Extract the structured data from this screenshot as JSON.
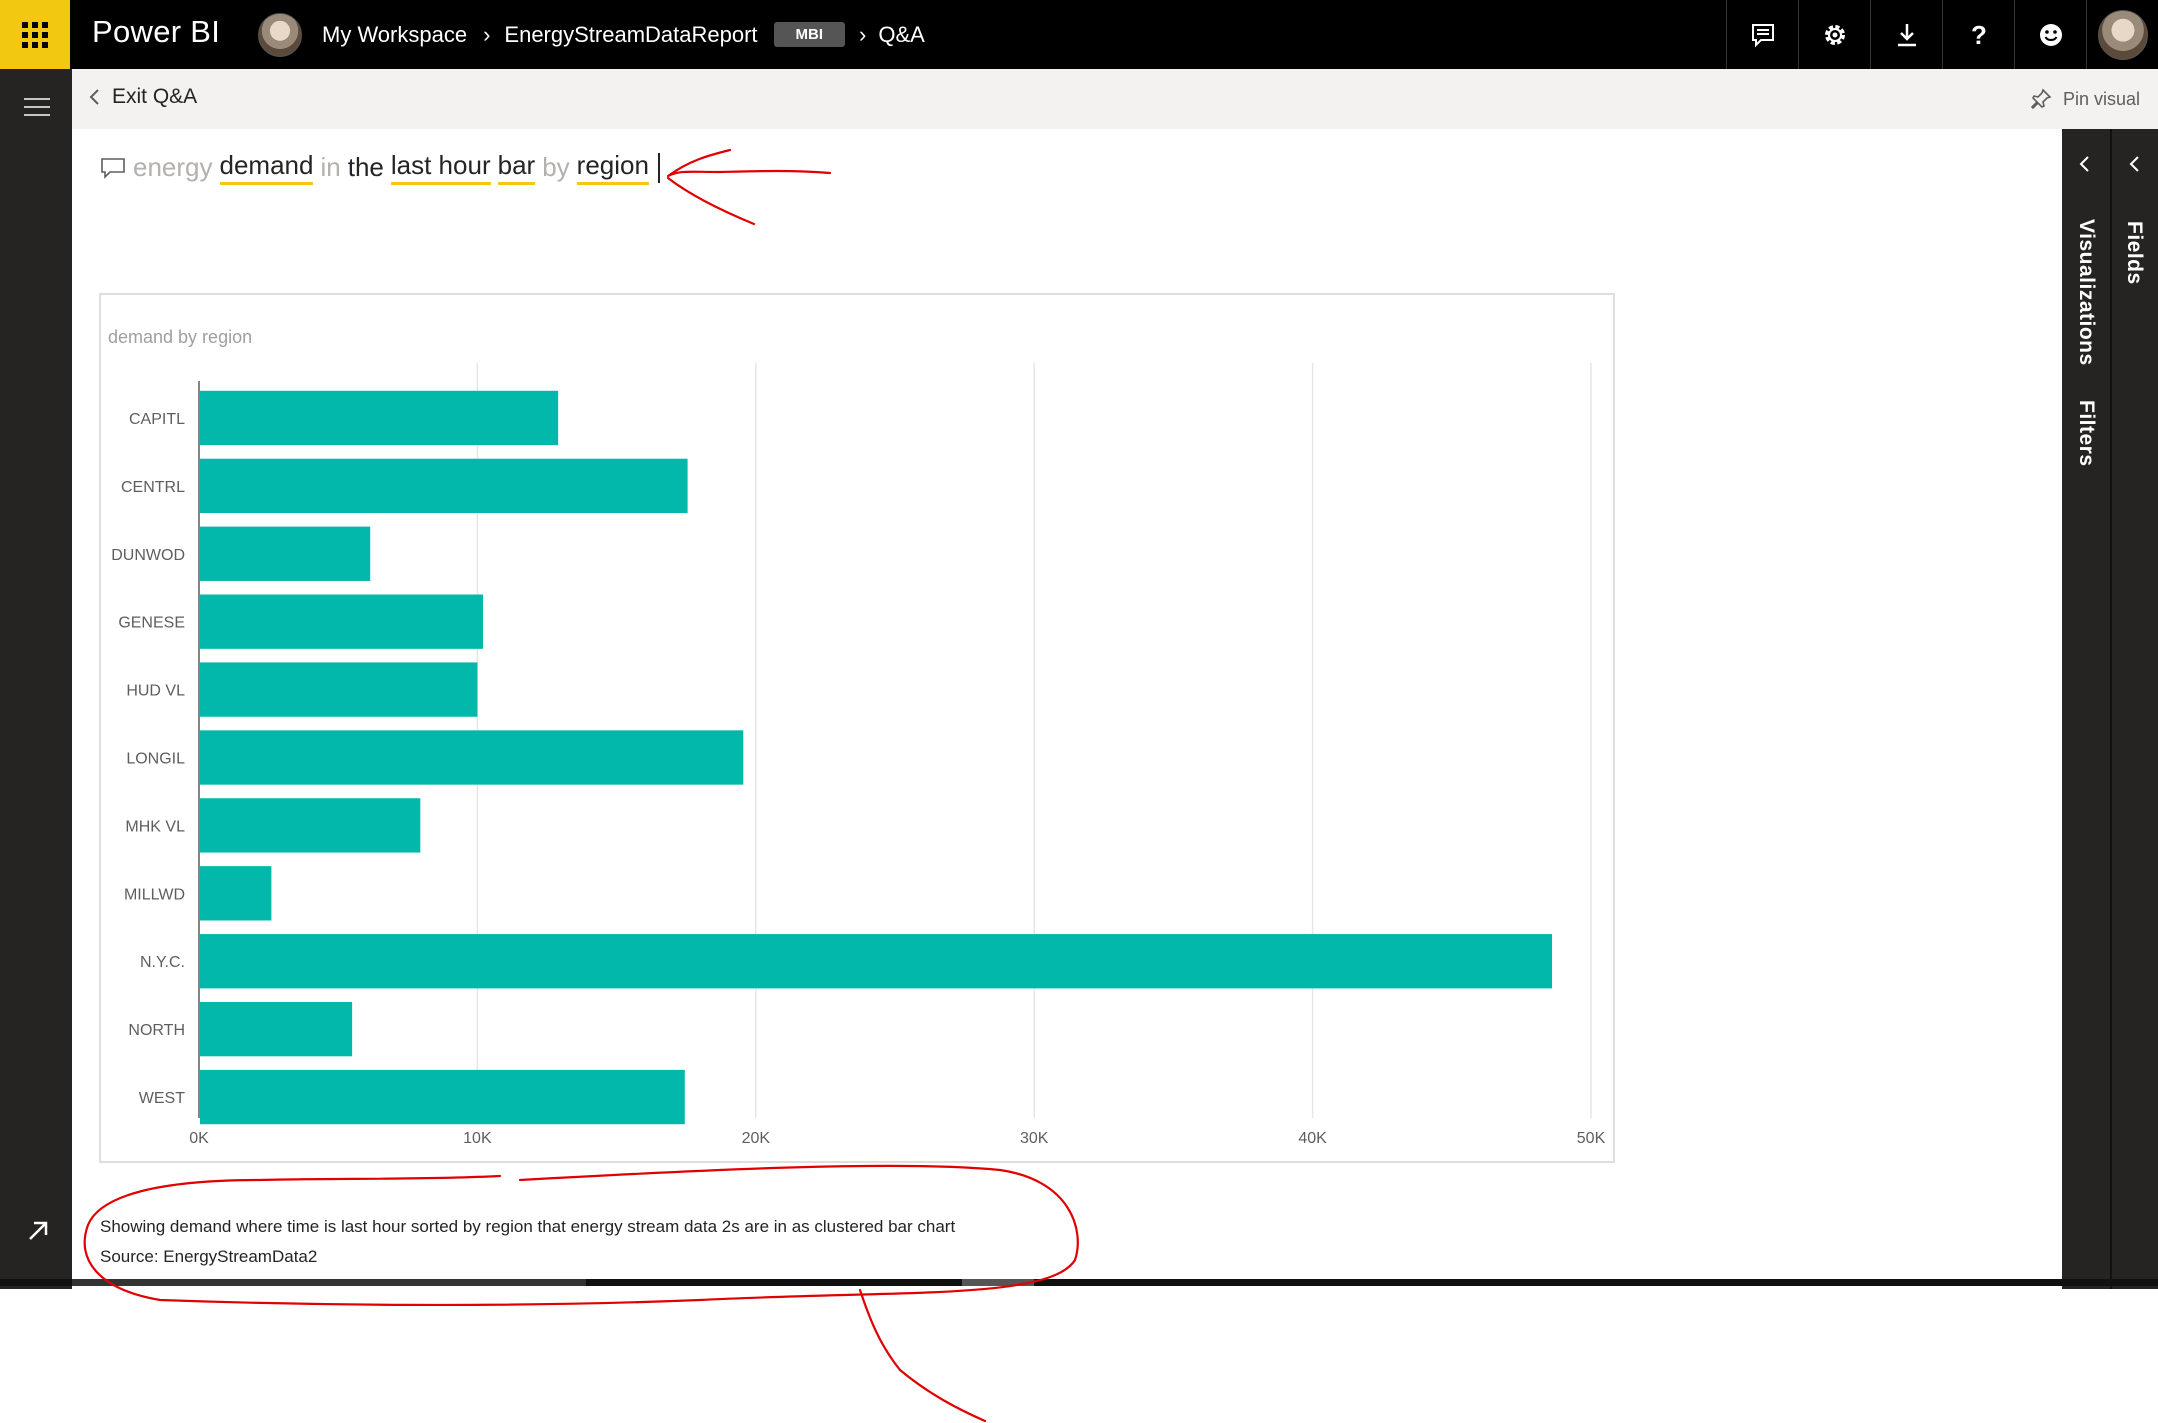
{
  "app": {
    "name": "Power BI"
  },
  "breadcrumb": {
    "workspace": "My Workspace",
    "report": "EnergyStreamDataReport",
    "badge": "MBI",
    "page": "Q&A"
  },
  "toolbar": {
    "exit_label": "Exit Q&A",
    "pin_label": "Pin visual"
  },
  "question": {
    "tokens": [
      {
        "text": "energy",
        "style": "grey"
      },
      {
        "text": "demand",
        "style": "term"
      },
      {
        "text": "in",
        "style": "grey"
      },
      {
        "text": "the",
        "style": "plain"
      },
      {
        "text": "last hour",
        "style": "term"
      },
      {
        "text": "bar",
        "style": "term"
      },
      {
        "text": "by",
        "style": "grey"
      },
      {
        "text": "region",
        "style": "term"
      }
    ]
  },
  "panes": {
    "visualizations": "Visualizations",
    "filters": "Filters",
    "fields": "Fields"
  },
  "chart_data": {
    "type": "bar",
    "orientation": "horizontal",
    "title": "demand by region",
    "categories": [
      "CAPITL",
      "CENTRL",
      "DUNWOD",
      "GENESE",
      "HUD VL",
      "LONGIL",
      "MHK VL",
      "MILLWD",
      "N.Y.C.",
      "NORTH",
      "WEST"
    ],
    "values": [
      12900,
      17550,
      6150,
      10200,
      10000,
      19550,
      7950,
      2600,
      48600,
      5500,
      17450
    ],
    "xticks": [
      "0K",
      "10K",
      "20K",
      "30K",
      "40K",
      "50K"
    ],
    "xlim": [
      0,
      50000
    ],
    "grid": true,
    "color": "#01b8aa"
  },
  "caption": {
    "line1": "Showing demand where time is last hour sorted by region that energy stream data 2s are in as clustered bar chart",
    "line2": "Source: EnergyStreamData2"
  },
  "colors": {
    "accent": "#f2c811",
    "bar": "#01b8aa",
    "annotation": "#e00000"
  }
}
